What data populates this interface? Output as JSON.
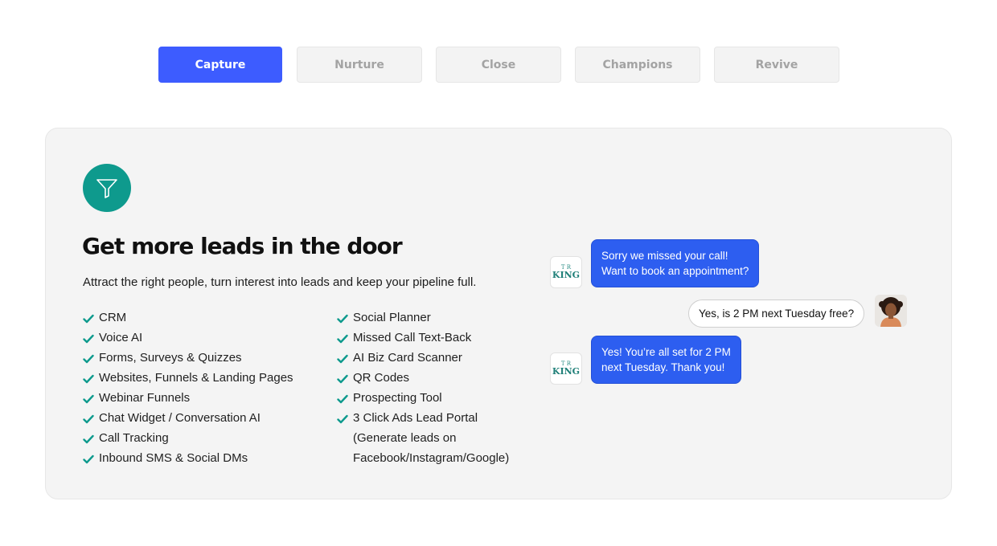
{
  "tabs": [
    {
      "label": "Capture",
      "active": true
    },
    {
      "label": "Nurture",
      "active": false
    },
    {
      "label": "Close",
      "active": false
    },
    {
      "label": "Champions",
      "active": false
    },
    {
      "label": "Revive",
      "active": false
    }
  ],
  "card": {
    "icon": "funnel-icon",
    "title": "Get more leads in the door",
    "subtitle": "Attract the right people, turn interest into leads and keep your pipeline full.",
    "features_left": [
      "CRM",
      "Voice AI",
      "Forms, Surveys & Quizzes",
      "Websites, Funnels & Landing Pages",
      "Webinar Funnels",
      "Chat Widget / Conversation AI",
      "Call Tracking",
      "Inbound SMS & Social DMs"
    ],
    "features_right": [
      "Social Planner",
      "Missed Call Text-Back",
      "AI Biz Card Scanner",
      "QR Codes",
      "Prospecting Tool",
      "3 Click Ads Lead Portal",
      "(Generate leads on",
      "Facebook/Instagram/Google)"
    ]
  },
  "chat": {
    "business_logo_text_top": "T R",
    "business_logo_text_main": "KING",
    "messages": [
      {
        "from": "business",
        "lines": [
          "Sorry we missed your call!",
          "Want to book an appointment?"
        ]
      },
      {
        "from": "user",
        "lines": [
          "Yes, is 2 PM next Tuesday free?"
        ]
      },
      {
        "from": "business",
        "lines": [
          "Yes! You’re all set for 2 PM",
          "next Tuesday. Thank you!"
        ]
      }
    ]
  },
  "colors": {
    "accent": "#3d5cff",
    "teal": "#0e9a8d",
    "bubble": "#2d5ef0"
  }
}
